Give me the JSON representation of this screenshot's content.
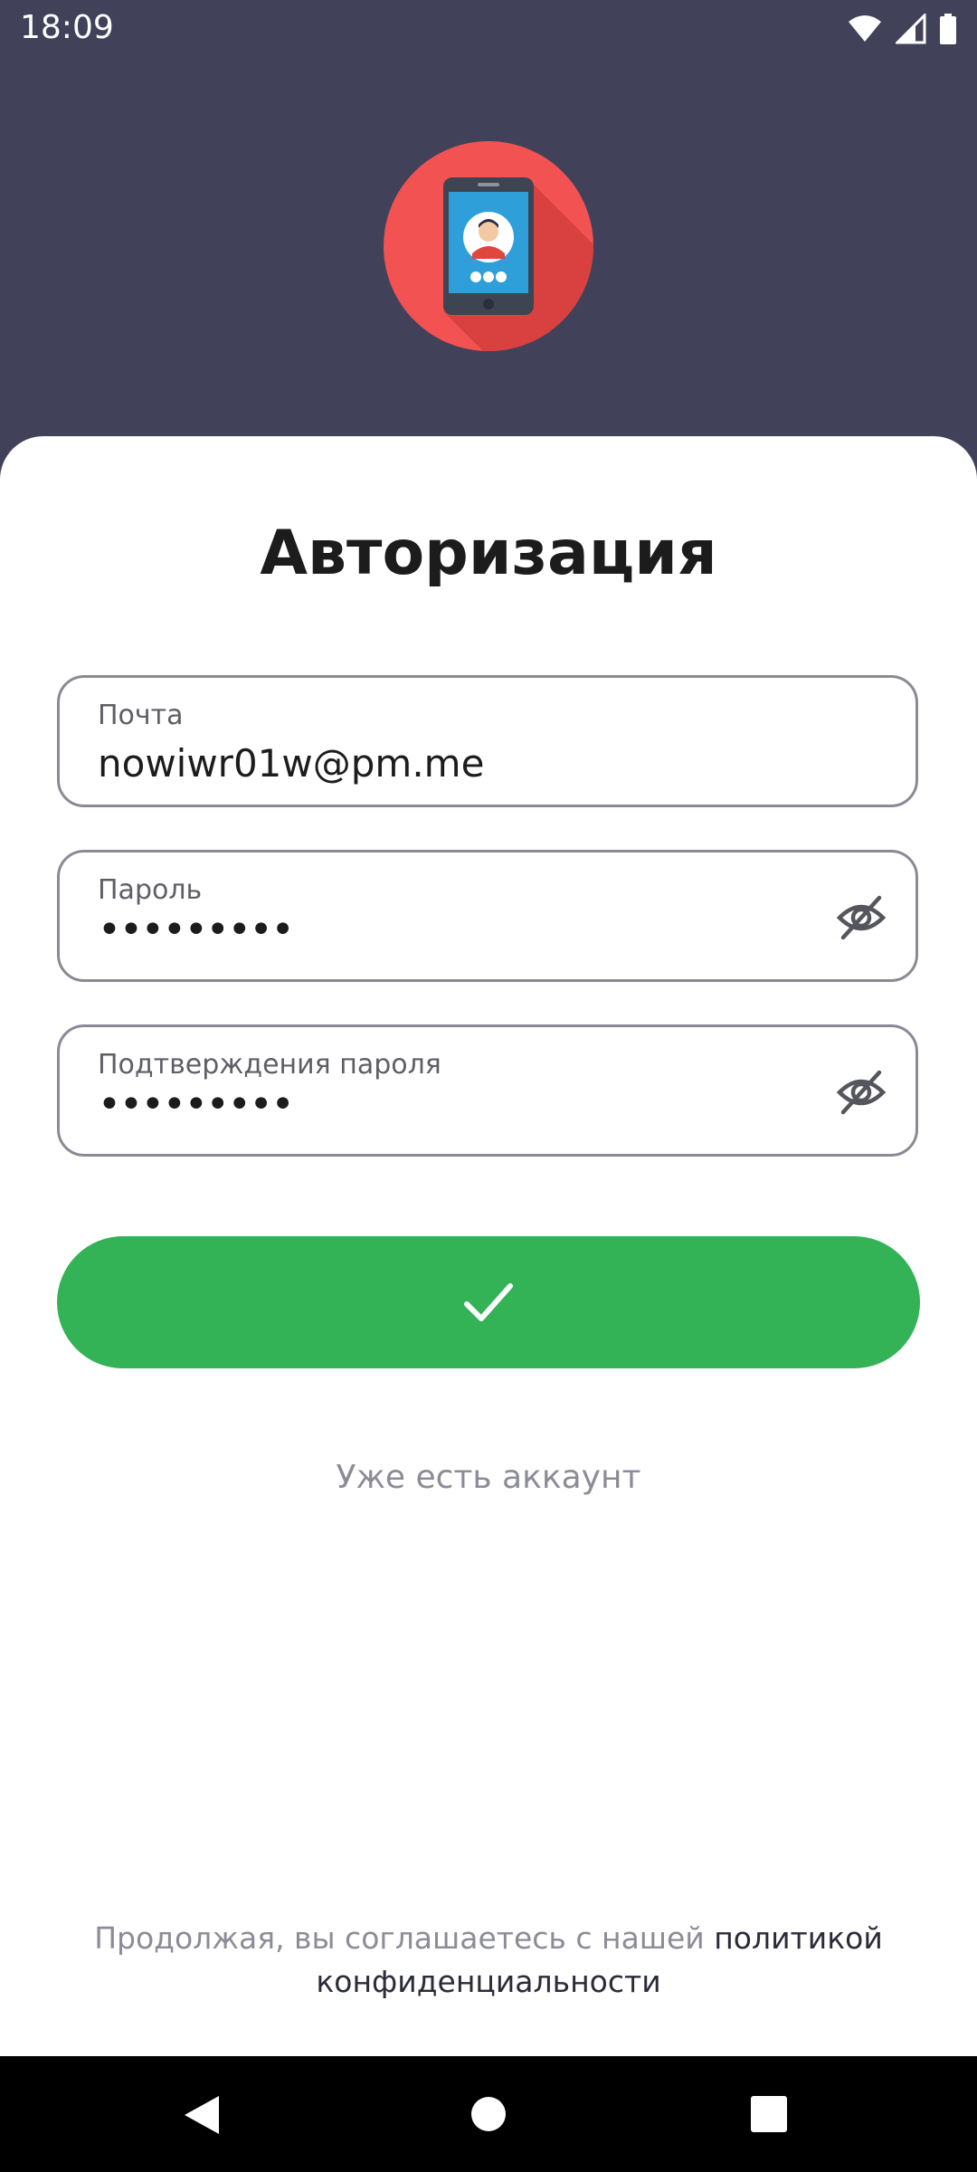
{
  "status_bar": {
    "time": "18:09",
    "icons": [
      "wifi-icon",
      "signal-icon",
      "battery-icon"
    ]
  },
  "header": {
    "logo": "phone-user-logo"
  },
  "form": {
    "title": "Авторизация",
    "email": {
      "label": "Почта",
      "value": "nowiwr01w@pm.me"
    },
    "password": {
      "label": "Пароль",
      "value": "•••••••••",
      "toggle_icon": "eye-off-icon"
    },
    "confirm_password": {
      "label": "Подтверждения пароля",
      "value": "•••••••••",
      "toggle_icon": "eye-off-icon"
    },
    "submit_icon": "check-icon",
    "login_link": "Уже есть аккаунт"
  },
  "footer": {
    "policy_prefix": "Продолжая, вы соглашаетесь с нашей ",
    "policy_link": "политикой конфиденциальности"
  },
  "nav_bar": {
    "buttons": [
      "back-icon",
      "home-icon",
      "recents-icon"
    ]
  },
  "colors": {
    "header_bg": "#41425a",
    "accent_green": "#33b256",
    "logo_red": "#f25252",
    "phone_blue": "#2e9fd8"
  }
}
